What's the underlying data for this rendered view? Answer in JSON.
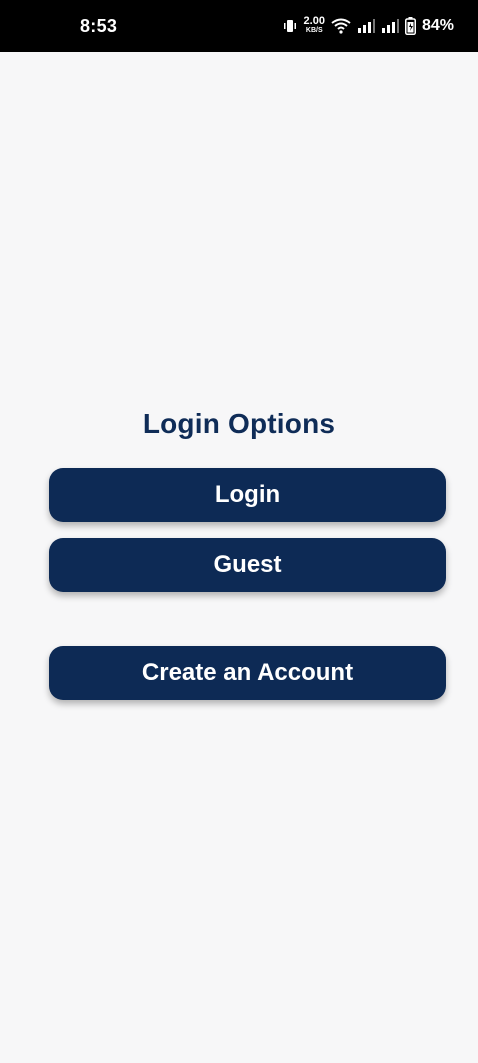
{
  "status_bar": {
    "time": "8:53",
    "net_speed_value": "2.00",
    "net_speed_unit": "KB/S",
    "battery_percent": "84%",
    "icons": [
      "vibrate-icon",
      "wifi-icon",
      "signal-icon",
      "signal-icon",
      "battery-icon"
    ]
  },
  "main": {
    "title": "Login Options",
    "buttons": {
      "login": "Login",
      "guest": "Guest",
      "create_account": "Create an Account"
    }
  },
  "colors": {
    "primary": "#0d2a55",
    "title": "#0f2c57",
    "background": "#f7f7f8",
    "status_bar": "#000000"
  }
}
